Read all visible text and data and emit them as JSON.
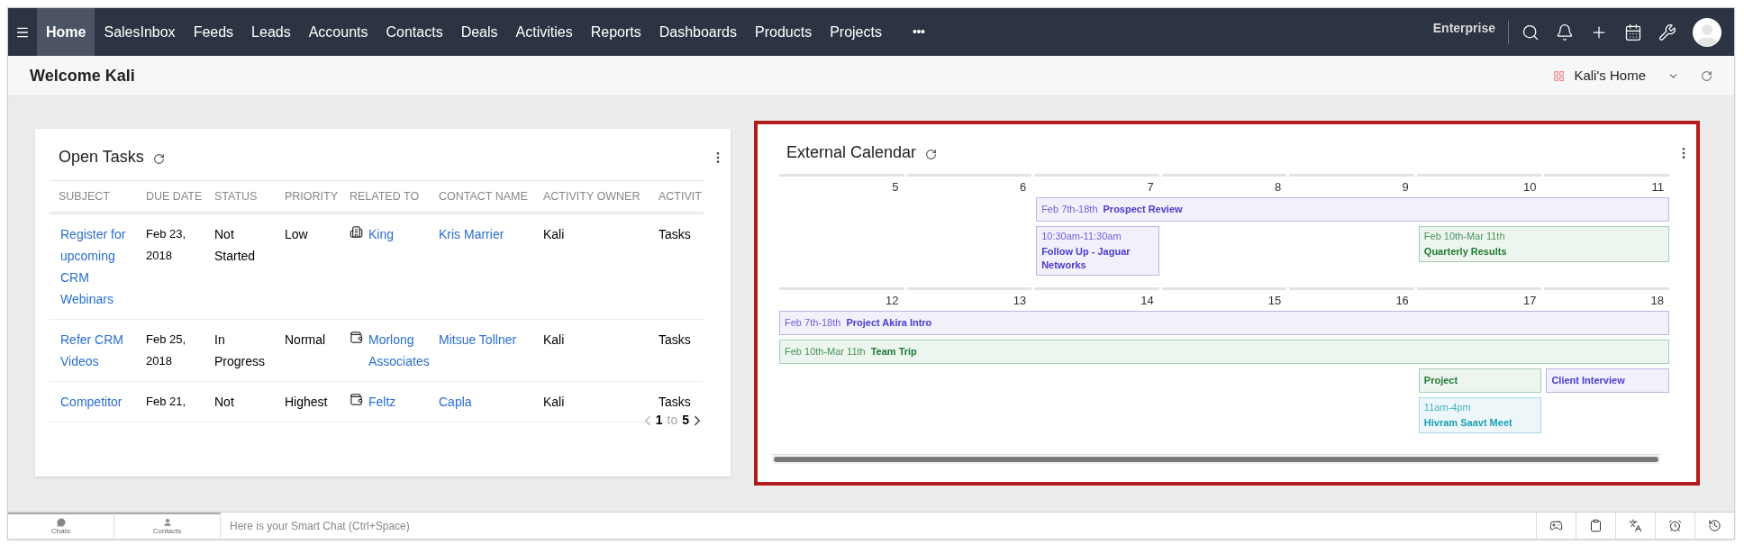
{
  "nav": {
    "items": [
      {
        "label": "Home",
        "selected": true
      },
      {
        "label": "SalesInbox",
        "selected": false
      },
      {
        "label": "Feeds",
        "selected": false
      },
      {
        "label": "Leads",
        "selected": false
      },
      {
        "label": "Accounts",
        "selected": false
      },
      {
        "label": "Contacts",
        "selected": false
      },
      {
        "label": "Deals",
        "selected": false
      },
      {
        "label": "Activities",
        "selected": false
      },
      {
        "label": "Reports",
        "selected": false
      },
      {
        "label": "Dashboards",
        "selected": false
      },
      {
        "label": "Products",
        "selected": false
      },
      {
        "label": "Projects",
        "selected": false
      }
    ],
    "more": "•••",
    "edition": "Enterprise"
  },
  "header": {
    "title": "Welcome Kali",
    "view": "Kali's Home"
  },
  "open_tasks": {
    "title": "Open Tasks",
    "columns": [
      "SUBJECT",
      "DUE DATE",
      "STATUS",
      "PRIORITY",
      "RELATED TO",
      "CONTACT NAME",
      "ACTIVITY OWNER",
      "ACTIVIT"
    ],
    "rows": [
      {
        "subject": "Register for upcoming CRM Webinars",
        "due_date": "Feb 23, 2018",
        "status": "Not Started",
        "priority": "Low",
        "related": {
          "kind": "building",
          "name": "King"
        },
        "contact": "Kris Marrier",
        "owner": "Kali",
        "activity": "Tasks"
      },
      {
        "subject": "Refer CRM Videos",
        "due_date": "Feb 25, 2018",
        "status": "In Progress",
        "priority": "Normal",
        "related": {
          "kind": "wallet",
          "name": "Morlong Associates"
        },
        "contact": "Mitsue Tollner",
        "owner": "Kali",
        "activity": "Tasks"
      },
      {
        "subject": "Competitor",
        "due_date": "Feb 21,",
        "status": "Not",
        "priority": "Highest",
        "related": {
          "kind": "wallet",
          "name": "Feltz"
        },
        "contact": "Capla",
        "owner": "Kali",
        "activity": "Tasks"
      }
    ],
    "pager": {
      "from": "1",
      "word": "to",
      "to": "5"
    }
  },
  "calendar": {
    "title": "External Calendar",
    "weeks": [
      {
        "days": [
          "5",
          "6",
          "7",
          "8",
          "9",
          "10",
          "11"
        ],
        "lanes": [
          [
            {
              "kind": "empty"
            },
            {
              "kind": "empty"
            },
            {
              "kind": "bar",
              "date": "Feb 7th-18th",
              "title": "Prospect Review",
              "color": "#4c3bd0"
            },
            {
              "kind": "continued"
            },
            {
              "kind": "continued"
            },
            {
              "kind": "continued"
            },
            {
              "kind": "continued"
            }
          ],
          [
            {
              "kind": "empty"
            },
            {
              "kind": "empty"
            },
            {
              "kind": "box",
              "date": "10:30am-11:30am",
              "title": "Follow Up - Jaguar Networks",
              "color": "#4c3bd0"
            },
            {
              "kind": "empty"
            },
            {
              "kind": "empty"
            },
            {
              "kind": "box",
              "date": "Feb 10th-Mar 11th",
              "title": "Quarterly Results",
              "color": "#1f7a35"
            },
            {
              "kind": "continued"
            }
          ]
        ]
      },
      {
        "days": [
          "12",
          "13",
          "14",
          "15",
          "16",
          "17",
          "18"
        ],
        "lanes": [
          [
            {
              "kind": "bar",
              "date": "Feb 7th-18th",
              "title": "Project Akira Intro",
              "color": "#4c3bd0"
            },
            {
              "kind": "continued"
            },
            {
              "kind": "continued"
            },
            {
              "kind": "continued"
            },
            {
              "kind": "continued"
            },
            {
              "kind": "continued"
            },
            {
              "kind": "continued"
            }
          ],
          [
            {
              "kind": "bar",
              "date": "Feb 10th-Mar 11th",
              "title": "Team Trip",
              "color": "#1f7a35"
            },
            {
              "kind": "continued"
            },
            {
              "kind": "continued"
            },
            {
              "kind": "continued"
            },
            {
              "kind": "continued"
            },
            {
              "kind": "continued"
            },
            {
              "kind": "continued"
            }
          ],
          [
            {
              "kind": "empty"
            },
            {
              "kind": "empty"
            },
            {
              "kind": "empty"
            },
            {
              "kind": "empty"
            },
            {
              "kind": "empty"
            },
            {
              "kind": "bar",
              "title": "Project",
              "color": "#1f7a35"
            },
            {
              "kind": "bar",
              "title": "Client Interview",
              "color": "#4c3bd0"
            }
          ],
          [
            {
              "kind": "empty"
            },
            {
              "kind": "empty"
            },
            {
              "kind": "empty"
            },
            {
              "kind": "empty"
            },
            {
              "kind": "empty"
            },
            {
              "kind": "box",
              "date": "11am-4pm",
              "title": "Hivram Saavt Meet",
              "color": "#1b9fb5"
            },
            {
              "kind": "empty"
            }
          ]
        ]
      }
    ]
  },
  "footer": {
    "tabs": [
      "Chats",
      "Contacts"
    ],
    "chat_placeholder": "Here is your Smart Chat (Ctrl+Space)"
  }
}
